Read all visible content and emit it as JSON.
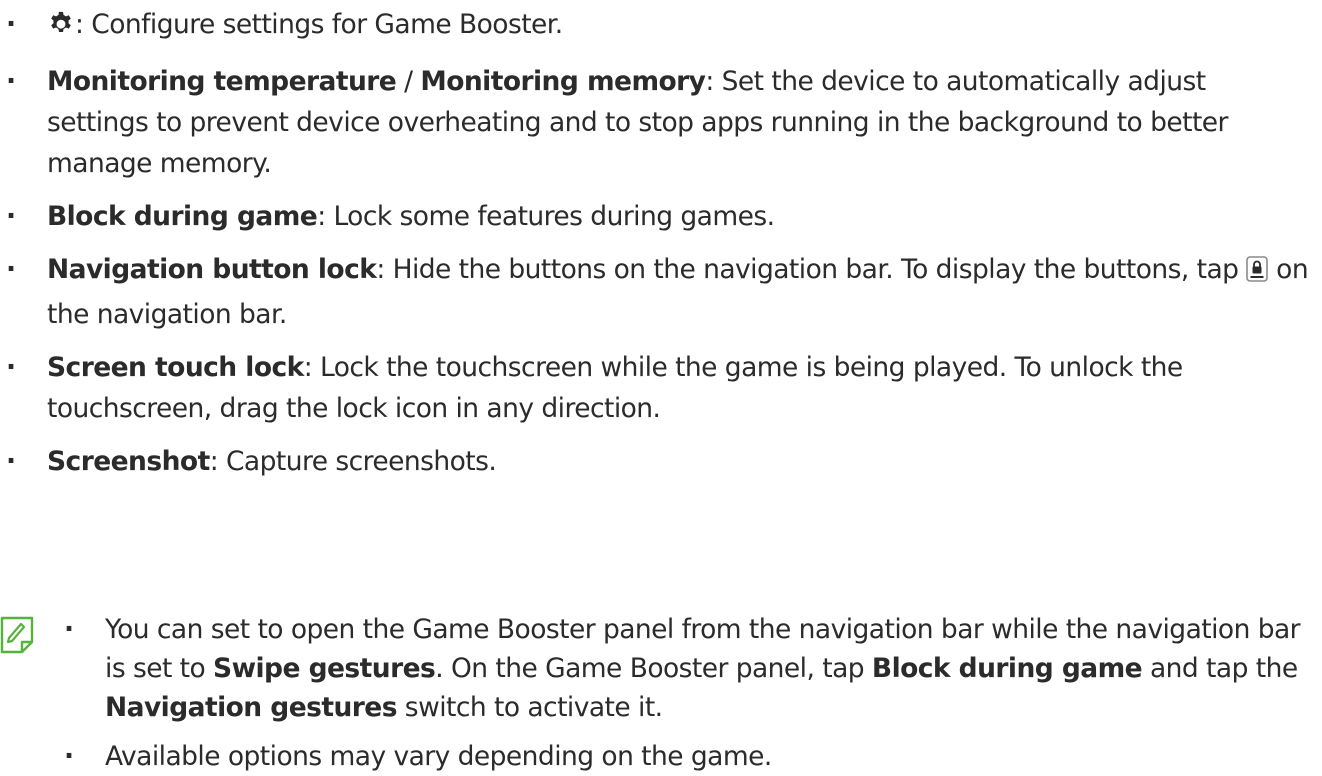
{
  "items": [
    {
      "text": ": Configure settings for Game Booster.",
      "icon": "gear-icon"
    },
    {
      "term": "Monitoring temperature",
      "separator": " / ",
      "term2": "Monitoring memory",
      "text": ": Set the device to automatically adjust settings to prevent device overheating and to stop apps running in the background to better manage memory."
    },
    {
      "term": "Block during game",
      "text": ": Lock some features during games."
    },
    {
      "term": "Navigation button lock",
      "text_before": ": Hide the buttons on the navigation bar. To display the buttons, tap ",
      "icon": "lock-icon",
      "text_after": " on the navigation bar."
    },
    {
      "term": "Screen touch lock",
      "text": ": Lock the touchscreen while the game is being played. To unlock the touchscreen, drag the lock icon in any direction."
    },
    {
      "term": "Screenshot",
      "text": ": Capture screenshots."
    }
  ],
  "note": {
    "icon": "note-pencil-icon",
    "icon_color": "#55b33c",
    "items": [
      {
        "t1": "You can set to open the Game Booster panel from the navigation bar while the navigation bar is set to ",
        "b1": "Swipe gestures",
        "t2": ". On the Game Booster panel, tap ",
        "b2": "Block during game",
        "t3": " and tap the ",
        "b3": "Navigation gestures",
        "t4": " switch to activate it."
      },
      {
        "text": "Available options may vary depending on the game."
      }
    ]
  }
}
